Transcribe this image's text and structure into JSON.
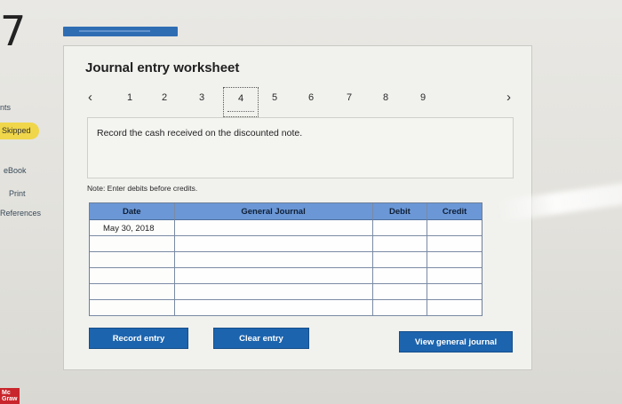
{
  "question_number": "7",
  "left_panel": {
    "points_label": "nts",
    "skipped_label": "Skipped",
    "ebook_label": "eBook",
    "print_label": "Print",
    "references_label": "References",
    "logo_text": "Mc Graw"
  },
  "worksheet": {
    "title": "Journal entry worksheet",
    "pager": {
      "pages": [
        "1",
        "2",
        "3",
        "4",
        "5",
        "6",
        "7",
        "8",
        "9"
      ],
      "active_page": "4",
      "prev_icon": "chevron-left-icon",
      "next_icon": "chevron-right-icon"
    },
    "prompt": "Record the cash received on the discounted note.",
    "note": "Note: Enter debits before credits.",
    "table": {
      "headers": [
        "Date",
        "General Journal",
        "Debit",
        "Credit"
      ],
      "rows": [
        {
          "date": "May 30, 2018",
          "account": "",
          "debit": "",
          "credit": ""
        },
        {
          "date": "",
          "account": "",
          "debit": "",
          "credit": ""
        },
        {
          "date": "",
          "account": "",
          "debit": "",
          "credit": ""
        },
        {
          "date": "",
          "account": "",
          "debit": "",
          "credit": ""
        },
        {
          "date": "",
          "account": "",
          "debit": "",
          "credit": ""
        },
        {
          "date": "",
          "account": "",
          "debit": "",
          "credit": ""
        }
      ]
    },
    "buttons": {
      "record": "Record entry",
      "clear": "Clear entry",
      "view": "View general journal"
    }
  },
  "colors": {
    "accent_blue": "#1d64ae",
    "table_header": "#6b97d6",
    "skipped_badge": "#f0d64a",
    "brand_red": "#c8262c"
  }
}
